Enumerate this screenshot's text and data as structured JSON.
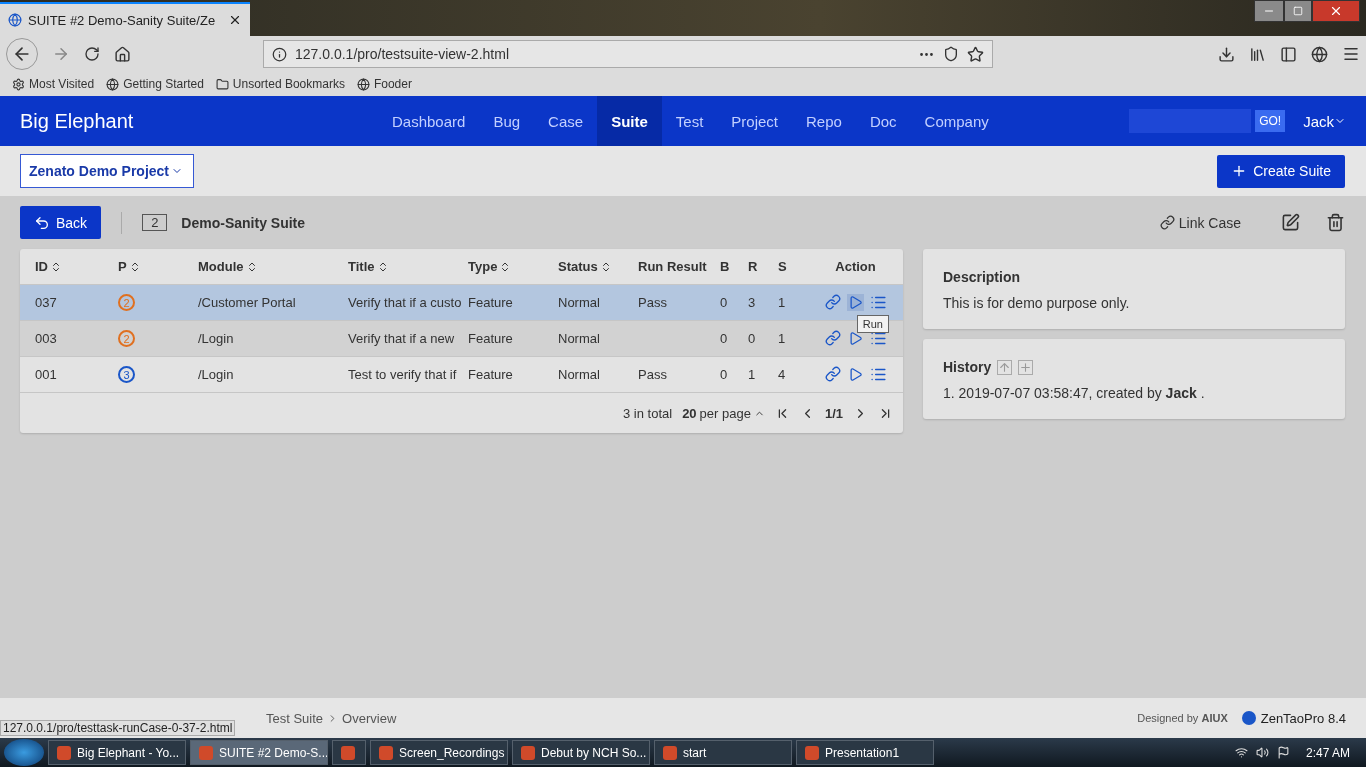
{
  "browser": {
    "tab": {
      "title": "SUITE #2 Demo-Sanity Suite/Ze",
      "selected": true
    },
    "url": "127.0.0.1/pro/testsuite-view-2.html",
    "bookmarks": [
      {
        "kind": "gear",
        "label": "Most Visited"
      },
      {
        "kind": "globe",
        "label": "Getting Started"
      },
      {
        "kind": "folder",
        "label": "Unsorted Bookmarks"
      },
      {
        "kind": "globe",
        "label": "Fooder"
      }
    ]
  },
  "app": {
    "brand": "Big Elephant",
    "nav": [
      {
        "label": "Dashboard",
        "selected": false
      },
      {
        "label": "Bug",
        "selected": false
      },
      {
        "label": "Case",
        "selected": false
      },
      {
        "label": "Suite",
        "selected": true
      },
      {
        "label": "Test",
        "selected": false
      },
      {
        "label": "Project",
        "selected": false
      },
      {
        "label": "Repo",
        "selected": false
      },
      {
        "label": "Doc",
        "selected": false
      },
      {
        "label": "Company",
        "selected": false
      }
    ],
    "search_button": "GO!",
    "user": "Jack"
  },
  "subheader": {
    "project": "Zenato Demo Project",
    "create_button": "Create Suite"
  },
  "suite": {
    "back": "Back",
    "id": "2",
    "name": "Demo-Sanity Suite",
    "link_case": "Link Case"
  },
  "table": {
    "columns": [
      {
        "label": "ID",
        "sortable": true
      },
      {
        "label": "P",
        "sortable": true
      },
      {
        "label": "Module",
        "sortable": true
      },
      {
        "label": "Title",
        "sortable": true
      },
      {
        "label": "Type",
        "sortable": true
      },
      {
        "label": "Status",
        "sortable": true
      },
      {
        "label": "Run Result",
        "sortable": false
      },
      {
        "label": "B",
        "sortable": false
      },
      {
        "label": "R",
        "sortable": false
      },
      {
        "label": "S",
        "sortable": false
      },
      {
        "label": "Action",
        "sortable": false
      }
    ],
    "rows": [
      {
        "id": "037",
        "priority": "2",
        "color": "#e07020",
        "module": "/Customer Portal",
        "title": "Verify that if a custo",
        "type": "Feature",
        "status": "Normal",
        "result": "Pass",
        "b": "0",
        "r": "3",
        "s": "1",
        "selected": true
      },
      {
        "id": "003",
        "priority": "2",
        "color": "#e07020",
        "module": "/Login",
        "title": "Verify that if a new",
        "type": "Feature",
        "status": "Normal",
        "result": "",
        "b": "0",
        "r": "0",
        "s": "1",
        "selected": false
      },
      {
        "id": "001",
        "priority": "3",
        "color": "#1a56c8",
        "module": "/Login",
        "title": "Test to verify that if",
        "type": "Feature",
        "status": "Normal",
        "result": "Pass",
        "b": "0",
        "r": "1",
        "s": "4",
        "selected": false
      }
    ],
    "tooltip": "Run",
    "total": "3 in total",
    "per_page": "20",
    "per_page_label": "per page",
    "page": "1/1"
  },
  "description": {
    "title": "Description",
    "text": "This is for demo purpose only."
  },
  "history": {
    "title": "History",
    "entries": [
      "1. 2019-07-07 03:58:47, created by **Jack** ."
    ]
  },
  "footer": {
    "breadcrumb": [
      "Test Suite",
      "Overview"
    ],
    "status_url": "127.0.0.1/pro/testtask-runCase-0-37-2.html",
    "designed_by": "Designed by",
    "designer": "AIUX",
    "version": "ZenTaoPro 8.4"
  },
  "taskbar": {
    "items": [
      {
        "label": "Big Elephant - Yo...",
        "selected": false
      },
      {
        "label": "SUITE #2 Demo-S...",
        "selected": true
      },
      {
        "selected": false
      },
      {
        "label": "Screen_Recordings",
        "selected": false
      },
      {
        "label": "Debut by NCH So...",
        "selected": false
      },
      {
        "label": "start",
        "selected": false
      },
      {
        "label": "Presentation1",
        "selected": false
      }
    ],
    "clock": "2:47 AM"
  }
}
